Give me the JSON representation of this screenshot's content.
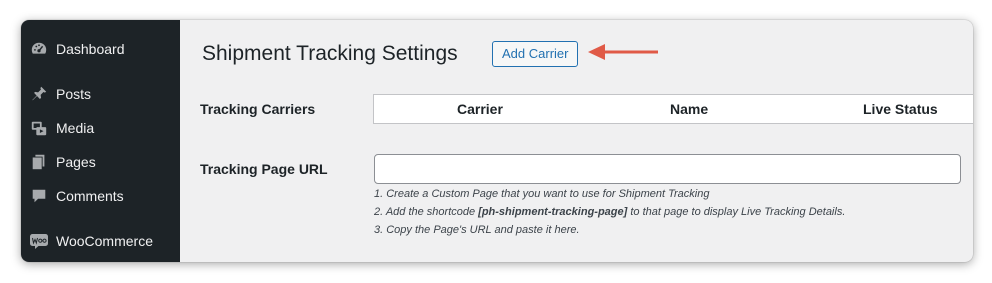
{
  "sidebar": {
    "items": [
      {
        "label": "Dashboard",
        "icon": "dashboard-icon"
      },
      {
        "label": "Posts",
        "icon": "pushpin-icon"
      },
      {
        "label": "Media",
        "icon": "media-icon"
      },
      {
        "label": "Pages",
        "icon": "pages-icon"
      },
      {
        "label": "Comments",
        "icon": "comment-icon"
      },
      {
        "label": "WooCommerce",
        "icon": "woocommerce-icon"
      }
    ]
  },
  "page": {
    "title": "Shipment Tracking Settings",
    "add_button": "Add Carrier"
  },
  "carriers": {
    "label": "Tracking Carriers",
    "columns": [
      "Carrier",
      "Name",
      "Live Status"
    ]
  },
  "tracking_url": {
    "label": "Tracking Page URL",
    "value": "",
    "placeholder": "",
    "help": {
      "line1": "1. Create a Custom Page that you want to use for Shipment Tracking",
      "line2_prefix": "2. Add the shortcode ",
      "line2_code": "[ph-shipment-tracking-page]",
      "line2_suffix": " to that page to display Live Tracking Details.",
      "line3": "3. Copy the Page's URL and paste it here."
    }
  },
  "colors": {
    "sidebar_bg": "#1d2327",
    "content_bg": "#f0f0f1",
    "accent": "#2271b1",
    "arrow": "#e05a47"
  }
}
